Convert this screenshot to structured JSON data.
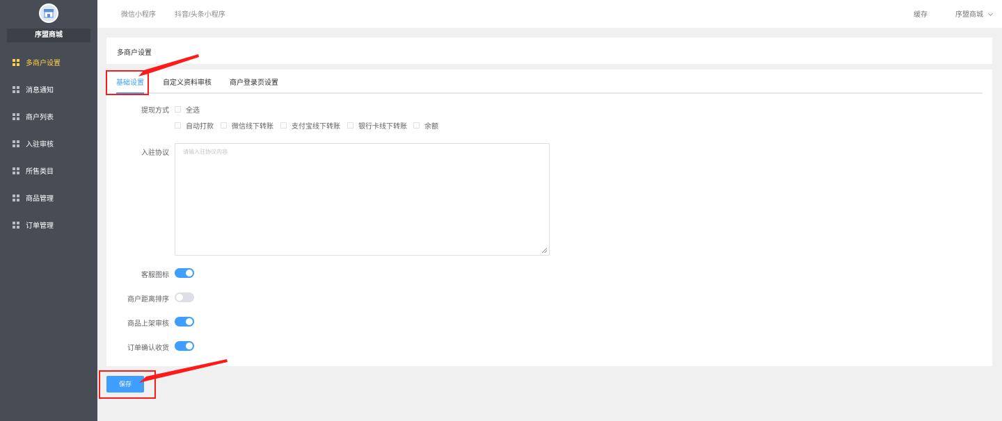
{
  "sidebar": {
    "shop_name": "序盟商城",
    "items": [
      {
        "label": "多商户设置",
        "active": true
      },
      {
        "label": "消息通知"
      },
      {
        "label": "商户列表"
      },
      {
        "label": "入驻审核"
      },
      {
        "label": "所售类目"
      },
      {
        "label": "商品管理"
      },
      {
        "label": "订单管理"
      }
    ]
  },
  "topbar": {
    "tabs": [
      "微信小程序",
      "抖音/头条小程序"
    ],
    "cache": "缓存",
    "store": "序盟商城"
  },
  "page_title": "多商户设置",
  "tabs": [
    "基础设置",
    "自定义资料审核",
    "商户登录页设置"
  ],
  "form": {
    "withdraw_label": "提现方式",
    "select_all": "全选",
    "methods": [
      "自动打款",
      "微信线下转账",
      "支付宝线下转账",
      "银行卡线下转账",
      "余额"
    ],
    "agreement_label": "入驻协议",
    "agreement_placeholder": "请输入驻协议内容",
    "service_icon_label": "客服图标",
    "distance_sort_label": "商户距离排序",
    "product_review_label": "商品上架审核",
    "order_confirm_label": "订单确认收货",
    "switches": {
      "service_icon": true,
      "distance_sort": false,
      "product_review": true,
      "order_confirm": true
    }
  },
  "save_label": "保存",
  "colors": {
    "sidebar": "#474c55",
    "active_nav": "#ffd04b",
    "primary": "#409eff",
    "annotation": "#ff1a1a"
  }
}
